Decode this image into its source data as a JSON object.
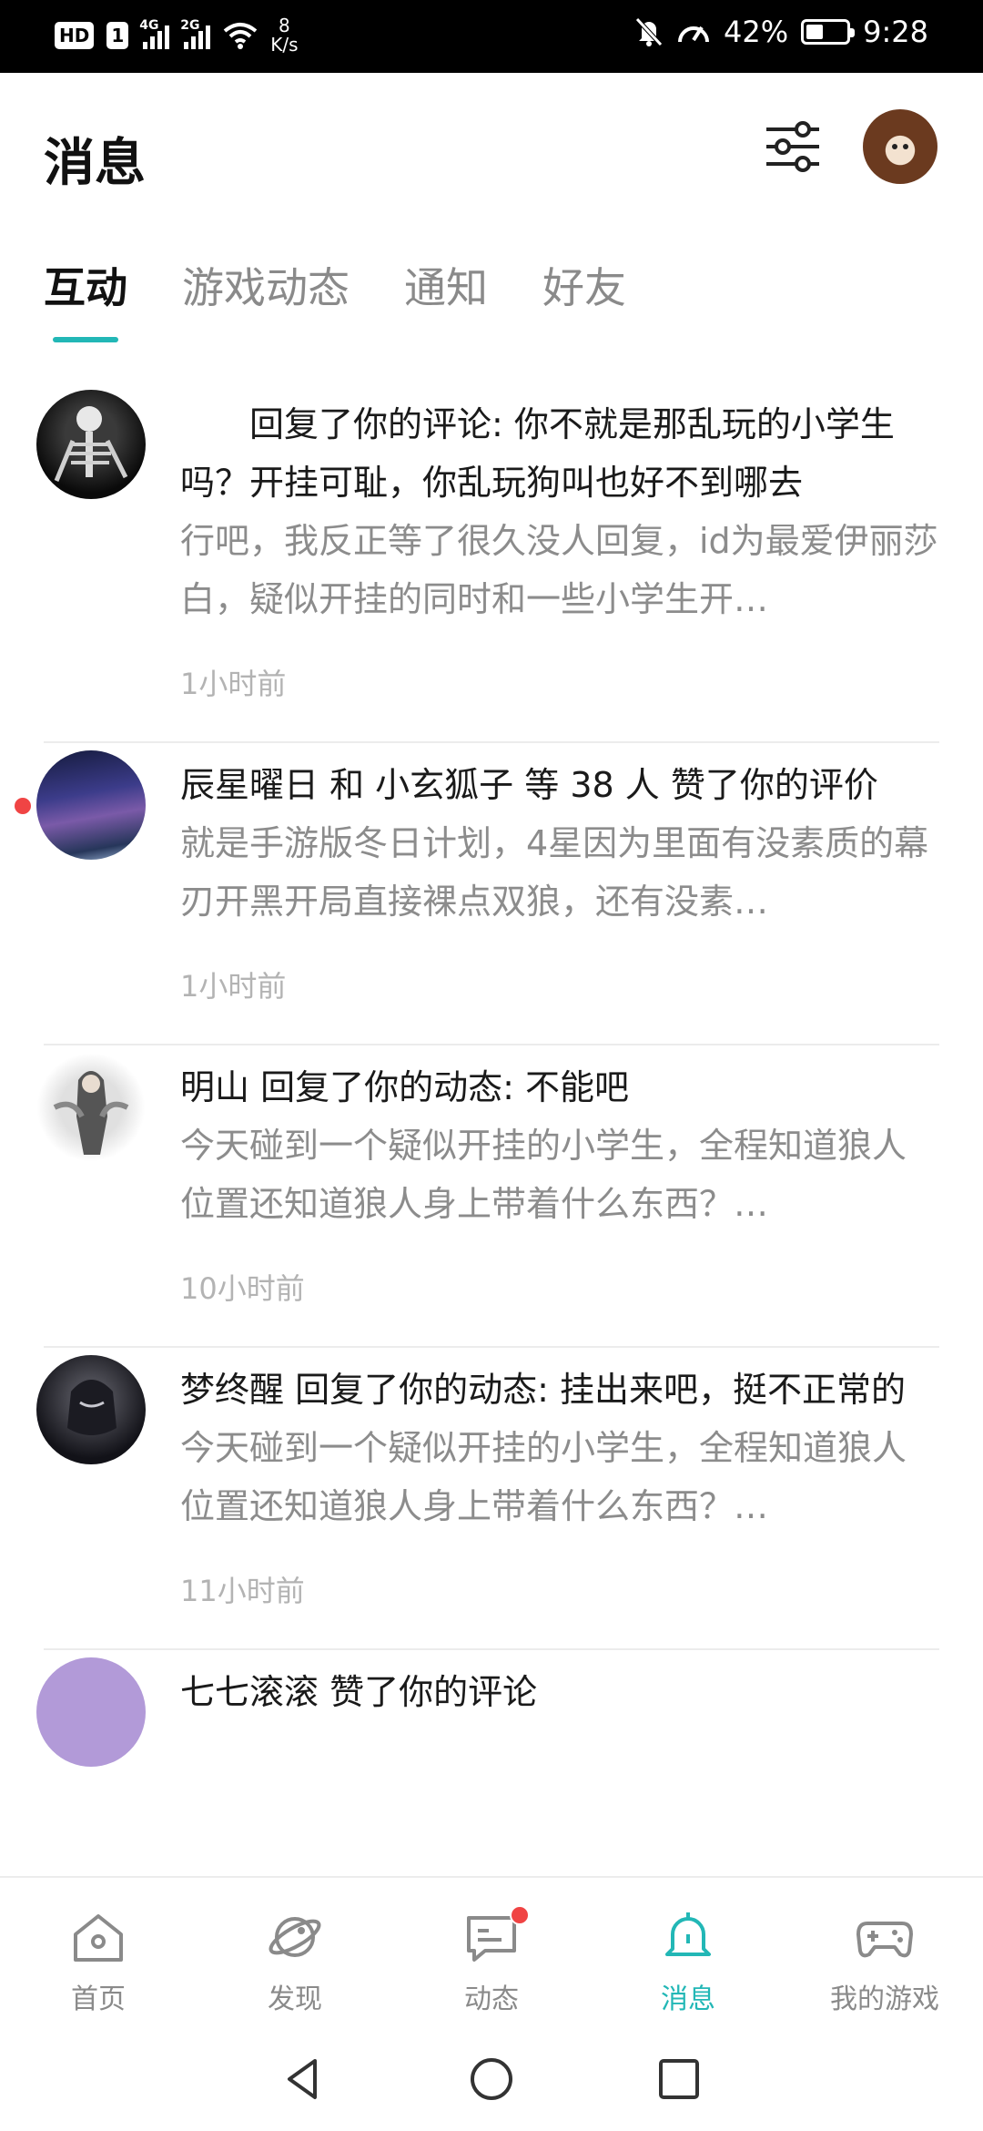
{
  "status_bar": {
    "hd": "HD",
    "sim": "1",
    "sig1_label": "4G",
    "sig2_label": "2G",
    "net_speed_value": "8",
    "net_speed_unit": "K/s",
    "battery_text": "42%",
    "battery_level": 0.42,
    "time": "9:28"
  },
  "header": {
    "title": "消息"
  },
  "tabs": [
    {
      "label": "互动",
      "active": true
    },
    {
      "label": "游戏动态",
      "active": false
    },
    {
      "label": "通知",
      "active": false
    },
    {
      "label": "好友",
      "active": false
    }
  ],
  "messages": [
    {
      "title": "　　回复了你的评论: 你不就是那乱玩的小学生吗？开挂可耻，你乱玩狗叫也好不到哪去",
      "preview": "行吧，我反正等了很久没人回复，id为最爱伊丽莎白，疑似开挂的同时和一些小学生开…",
      "time": "1小时前",
      "unread": false
    },
    {
      "title": "辰星曜日 和 小玄狐子 等 38 人 赞了你的评价",
      "preview": "就是手游版冬日计划，4星因为里面有没素质的幕刃开黑开局直接裸点双狼，还有没素…",
      "time": "1小时前",
      "unread": true
    },
    {
      "title": "明山 回复了你的动态: 不能吧",
      "preview": "今天碰到一个疑似开挂的小学生，全程知道狼人位置还知道狼人身上带着什么东西？…",
      "time": "10小时前",
      "unread": false
    },
    {
      "title": "梦终醒 回复了你的动态: 挂出来吧，挺不正常的",
      "preview": "今天碰到一个疑似开挂的小学生，全程知道狼人位置还知道狼人身上带着什么东西？…",
      "time": "11小时前",
      "unread": false
    },
    {
      "title": "七七滚滚 赞了你的评论",
      "preview": "",
      "time": "",
      "unread": false
    }
  ],
  "bottom_nav": [
    {
      "label": "首页",
      "icon": "home-icon"
    },
    {
      "label": "发现",
      "icon": "planet-icon"
    },
    {
      "label": "动态",
      "icon": "chat-icon",
      "badge": true
    },
    {
      "label": "消息",
      "icon": "bell-icon",
      "active": true
    },
    {
      "label": "我的游戏",
      "icon": "gamepad-icon"
    }
  ],
  "colors": {
    "accent": "#22b7b6",
    "unread": "#f04444",
    "muted_text": "#8c8c8c"
  }
}
